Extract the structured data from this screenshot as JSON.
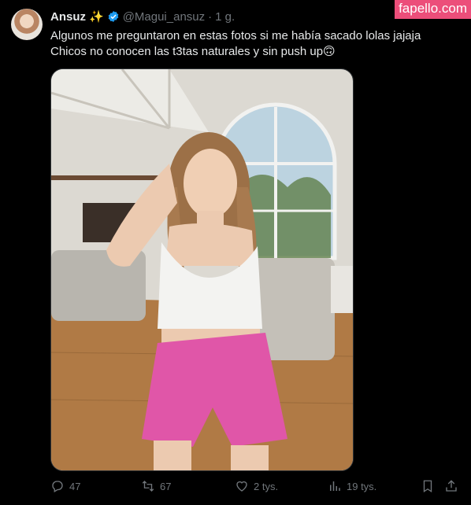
{
  "watermark": "fapello.com",
  "user": {
    "name": "Ansuz",
    "emoji": "✨",
    "handle": "@Magui_ansuz",
    "separator": "·",
    "time": "1 g."
  },
  "tweet": {
    "line1": "Algunos me preguntaron en estas fotos si me había sacado lolas jajaja",
    "line2": "Chicos no conocen las t3tas naturales y sin push up",
    "line2_emoji": "🙃"
  },
  "actions": {
    "replies": "47",
    "reposts": "67",
    "likes": "2 tys.",
    "views": "19 tys."
  },
  "colors": {
    "background": "#000000",
    "text": "#e7e9ea",
    "muted": "#71767b",
    "verified": "#1d9bf0",
    "watermark_bg": "#ec4e7a"
  },
  "icons": [
    "verified-badge-icon",
    "reply-icon",
    "repost-icon",
    "like-icon",
    "views-icon",
    "bookmark-icon",
    "share-icon"
  ]
}
